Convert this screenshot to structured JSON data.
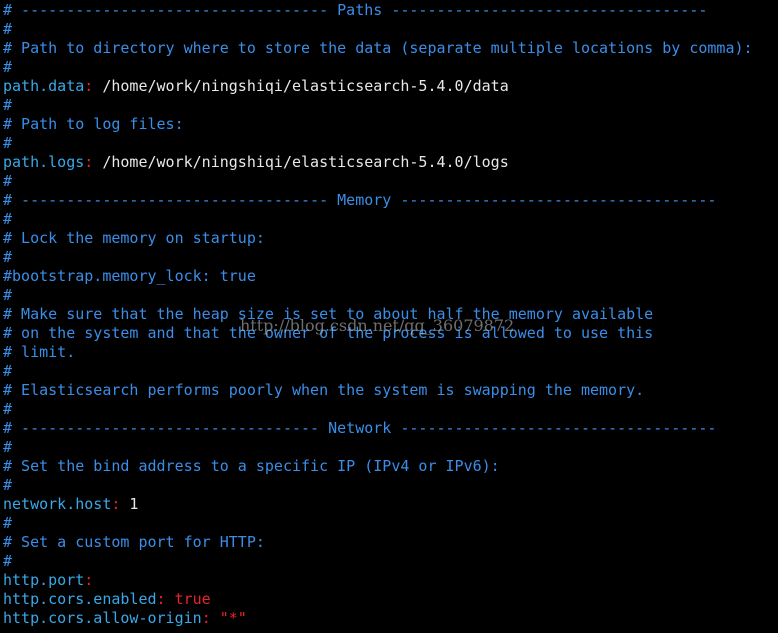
{
  "colors": {
    "background": "#000000",
    "comment": "#3a8ee8",
    "key": "#38a8e8",
    "punctuation": "#e8232a",
    "value": "#e8e8e8"
  },
  "lines": [
    {
      "type": "comment",
      "text": "# ---------------------------------- Paths -----------------------------------"
    },
    {
      "type": "comment",
      "text": "#"
    },
    {
      "type": "comment",
      "text": "# Path to directory where to store the data (separate multiple locations by comma):"
    },
    {
      "type": "comment",
      "text": "#"
    },
    {
      "type": "setting",
      "key": "path.data",
      "colon": ":",
      "value": " /home/work/ningshiqi/elasticsearch-5.4.0/data"
    },
    {
      "type": "comment",
      "text": "#"
    },
    {
      "type": "comment",
      "text": "# Path to log files:"
    },
    {
      "type": "comment",
      "text": "#"
    },
    {
      "type": "setting",
      "key": "path.logs",
      "colon": ":",
      "value": " /home/work/ningshiqi/elasticsearch-5.4.0/logs"
    },
    {
      "type": "comment",
      "text": "#"
    },
    {
      "type": "comment",
      "text": "# ---------------------------------- Memory -----------------------------------"
    },
    {
      "type": "comment",
      "text": "#"
    },
    {
      "type": "comment",
      "text": "# Lock the memory on startup:"
    },
    {
      "type": "comment",
      "text": "#"
    },
    {
      "type": "comment",
      "text": "#bootstrap.memory_lock: true"
    },
    {
      "type": "comment",
      "text": "#"
    },
    {
      "type": "comment",
      "text": "# Make sure that the heap size is set to about half the memory available"
    },
    {
      "type": "comment",
      "text": "# on the system and that the owner of the process is allowed to use this"
    },
    {
      "type": "comment",
      "text": "# limit."
    },
    {
      "type": "comment",
      "text": "#"
    },
    {
      "type": "comment",
      "text": "# Elasticsearch performs poorly when the system is swapping the memory."
    },
    {
      "type": "comment",
      "text": "#"
    },
    {
      "type": "comment",
      "text": "# --------------------------------- Network -----------------------------------"
    },
    {
      "type": "comment",
      "text": "#"
    },
    {
      "type": "comment",
      "text": "# Set the bind address to a specific IP (IPv4 or IPv6):"
    },
    {
      "type": "comment",
      "text": "#"
    },
    {
      "type": "setting",
      "key": "network.host",
      "colon": ":",
      "value": " 1"
    },
    {
      "type": "comment",
      "text": "#"
    },
    {
      "type": "comment",
      "text": "# Set a custom port for HTTP:"
    },
    {
      "type": "comment",
      "text": "#"
    },
    {
      "type": "setting",
      "key": "http.port",
      "colon": ":",
      "value": ""
    },
    {
      "type": "setting",
      "key": "http.cors.enabled",
      "colon": ":",
      "value": " true",
      "value_color": "red"
    },
    {
      "type": "setting",
      "key": "http.cors.allow-origin",
      "colon": ":",
      "value": " \"*\"",
      "value_color": "red"
    }
  ],
  "watermark": "http://blog.csdn.net/qq_36079872"
}
